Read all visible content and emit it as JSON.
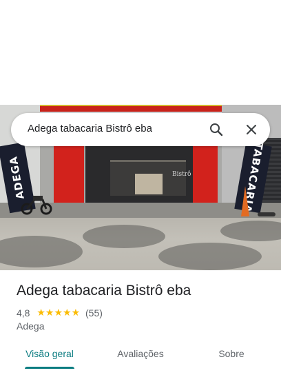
{
  "search": {
    "query": "Adega tabacaria Bistrô eba"
  },
  "photo": {
    "banner_left_text": "ADEGA",
    "banner_right_text": "TABACARIA",
    "store_sign": "Bistrô"
  },
  "place": {
    "title": "Adega tabacaria Bistrô eba",
    "rating": "4,8",
    "stars": "★★★★★",
    "review_count": "(55)",
    "category": "Adega"
  },
  "tabs": [
    {
      "label": "Visão geral",
      "selected": true
    },
    {
      "label": "Avaliações",
      "selected": false
    },
    {
      "label": "Sobre",
      "selected": false
    }
  ],
  "colors": {
    "accent": "#0b7c81",
    "star": "#fbbc04",
    "text_primary": "#202124",
    "text_secondary": "#5f6368"
  },
  "icons": {
    "search": "search-icon",
    "close": "close-icon"
  }
}
